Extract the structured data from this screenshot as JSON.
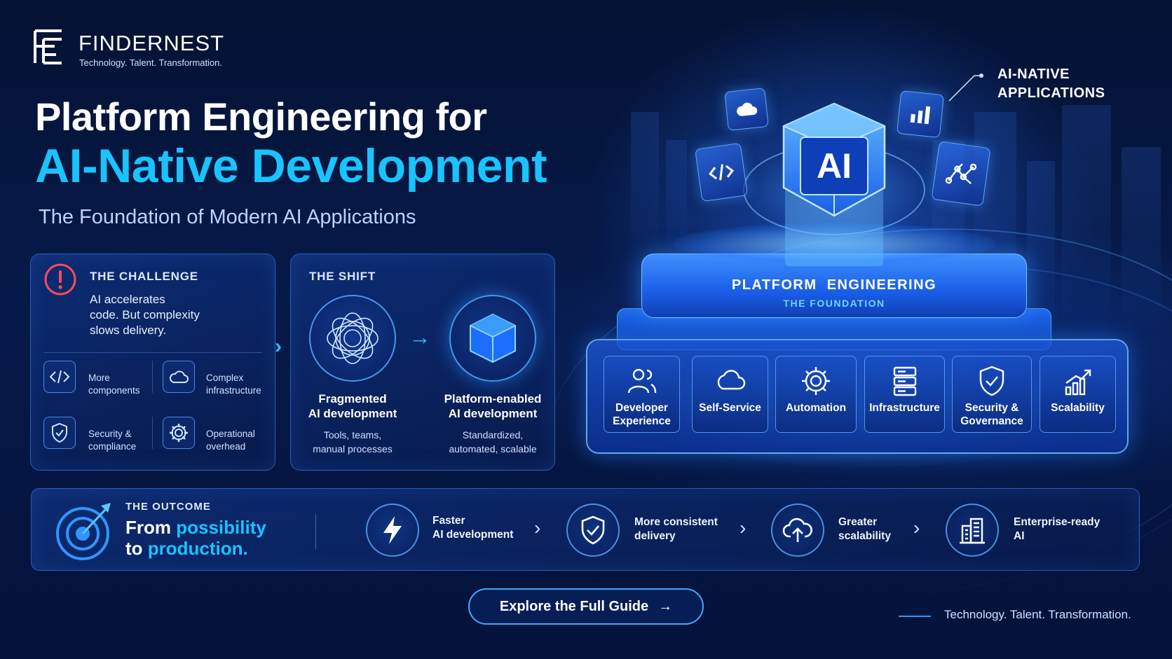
{
  "brand": {
    "name": "FINDERNEST",
    "tagline": "Technology. Talent. Transformation."
  },
  "hero": {
    "title_line1": "Platform Engineering for",
    "title_line2": "AI-Native Development",
    "subtitle": "The Foundation of Modern AI Applications"
  },
  "challenge": {
    "label": "THE CHALLENGE",
    "text_lines": [
      "AI accelerates",
      "code. But complexity",
      "slows delivery."
    ],
    "items": [
      {
        "icon": "code-icon",
        "lines": [
          "More",
          "components"
        ]
      },
      {
        "icon": "cloud-icon",
        "lines": [
          "Complex",
          "infrastructure"
        ]
      },
      {
        "icon": "shield-icon",
        "lines": [
          "Security &",
          "compliance"
        ]
      },
      {
        "icon": "gear-icon",
        "lines": [
          "Operational",
          "overhead"
        ]
      }
    ]
  },
  "shift": {
    "label": "THE SHIFT",
    "from": {
      "title_lines": [
        "Fragmented",
        "AI development"
      ],
      "desc_lines": [
        "Tools, teams,",
        "manual processes"
      ]
    },
    "to": {
      "title_lines": [
        "Platform-enabled",
        "AI development"
      ],
      "desc_lines": [
        "Standardized,",
        "automated, scalable"
      ]
    }
  },
  "platform": {
    "core_label": "AI",
    "callout_lines": [
      "AI-NATIVE",
      "APPLICATIONS"
    ],
    "title": "PLATFORM  ENGINEERING",
    "subtitle": "THE FOUNDATION",
    "pillars": [
      {
        "icon": "users-icon",
        "lines": [
          "Developer",
          "Experience"
        ]
      },
      {
        "icon": "cloud-icon",
        "lines": [
          "Self-Service"
        ]
      },
      {
        "icon": "gear-icon",
        "lines": [
          "Automation"
        ]
      },
      {
        "icon": "server-icon",
        "lines": [
          "Infrastructure"
        ]
      },
      {
        "icon": "shield-check-icon",
        "lines": [
          "Security &",
          "Governance"
        ]
      },
      {
        "icon": "growth-chart-icon",
        "lines": [
          "Scalability"
        ]
      }
    ]
  },
  "outcome": {
    "label": "THE OUTCOME",
    "headline_a1": "From ",
    "headline_b1": "possibility",
    "headline_a2": "to ",
    "headline_b2": "production.",
    "items": [
      {
        "icon": "lightning-icon",
        "lines": [
          "Faster",
          "AI development"
        ]
      },
      {
        "icon": "shield-check-icon",
        "lines": [
          "More consistent",
          "delivery"
        ]
      },
      {
        "icon": "cloud-upload-icon",
        "lines": [
          "Greater",
          "scalability"
        ]
      },
      {
        "icon": "building-icon",
        "lines": [
          "Enterprise-ready",
          "AI"
        ]
      }
    ]
  },
  "cta": {
    "label": "Explore the Full Guide",
    "arrow": "→"
  },
  "footer": {
    "tagline": "Technology. Talent. Transformation."
  },
  "colors": {
    "accent": "#19c3ff",
    "background": "#061a4a",
    "alert": "#ff4a5a"
  }
}
